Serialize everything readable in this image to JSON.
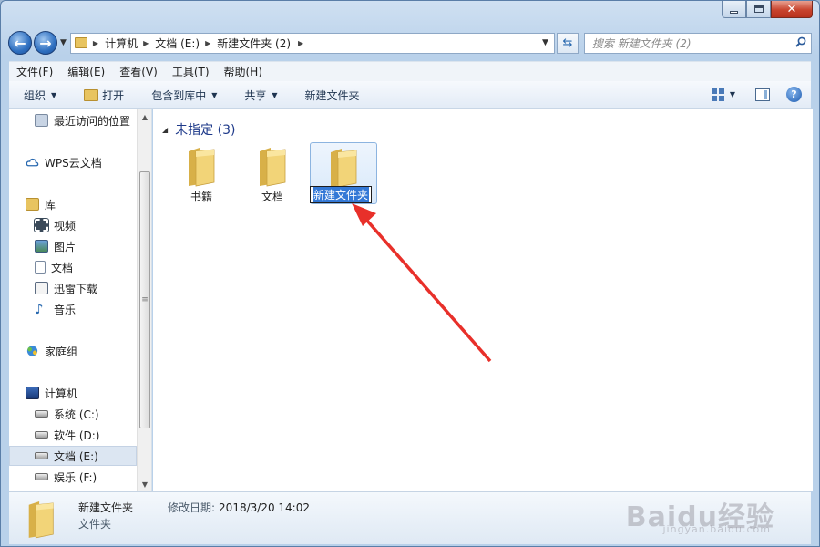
{
  "address": {
    "breadcrumbs": [
      "计算机",
      "文档 (E:)",
      "新建文件夹 (2)"
    ],
    "search_placeholder": "搜索 新建文件夹 (2)"
  },
  "menu": [
    "文件(F)",
    "编辑(E)",
    "查看(V)",
    "工具(T)",
    "帮助(H)"
  ],
  "toolbar": {
    "organize": "组织",
    "open": "打开",
    "include_library": "包含到库中",
    "share": "共享",
    "new_folder": "新建文件夹"
  },
  "nav": {
    "recent": "最近访问的位置",
    "wps": "WPS云文档",
    "libraries": "库",
    "videos": "视频",
    "pictures": "图片",
    "documents": "文档",
    "xunlei": "迅雷下载",
    "music": "音乐",
    "homegroup": "家庭组",
    "computer": "计算机",
    "drives": [
      "系统 (C:)",
      "软件 (D:)",
      "文档 (E:)",
      "娱乐 (F:)"
    ]
  },
  "content": {
    "group_title": "未指定 (3)",
    "folders": [
      "书籍",
      "文档",
      "新建文件夹"
    ],
    "rename_value": "新建文件夹"
  },
  "details": {
    "name": "新建文件夹",
    "modified_label": "修改日期:",
    "modified_value": "2018/3/20 14:02",
    "type": "文件夹"
  },
  "watermark": {
    "text": "Baidu经验",
    "sub": "jingyan.baidu.com"
  },
  "colors": {
    "accent": "#3378d6",
    "group_title": "#1e3a8a",
    "annotation_arrow": "#e8302a",
    "folder": "#e8c460"
  }
}
